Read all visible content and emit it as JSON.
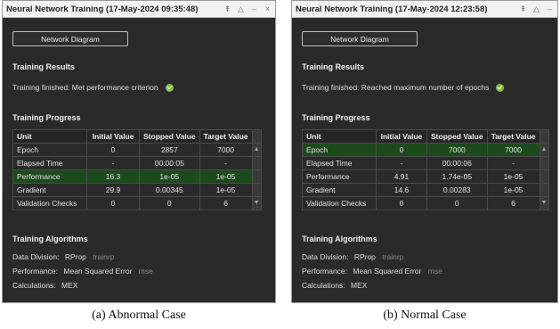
{
  "panels": [
    {
      "title": "Neural Network Training (17-May-2024 09:35:48)",
      "network_diagram_button": "Network Diagram",
      "training_results_heading": "Training Results",
      "training_results_text": "Training finished: Met performance criterion",
      "training_progress_heading": "Training Progress",
      "columns": [
        "Unit",
        "Initial Value",
        "Stopped Value",
        "Target Value"
      ],
      "rows": [
        {
          "unit": "Epoch",
          "initial": "0",
          "stopped": "2857",
          "target": "7000"
        },
        {
          "unit": "Elapsed Time",
          "initial": "-",
          "stopped": "00:00:05",
          "target": "-"
        },
        {
          "unit": "Performance",
          "initial": "16.3",
          "stopped": "1e-05",
          "target": "1e-05"
        },
        {
          "unit": "Gradient",
          "initial": "29.9",
          "stopped": "0.00345",
          "target": "1e-05"
        },
        {
          "unit": "Validation Checks",
          "initial": "0",
          "stopped": "0",
          "target": "6"
        }
      ],
      "highlighted_row": "Performance",
      "algorithms_heading": "Training Algorithms",
      "algorithms": [
        {
          "label": "Data Division:",
          "value": "RProp",
          "fn": "trainrp"
        },
        {
          "label": "Performance:",
          "value": "Mean Squared Error",
          "fn": "mse"
        },
        {
          "label": "Calculations:",
          "value": "MEX",
          "fn": ""
        }
      ],
      "caption": "(a) Abnormal Case"
    },
    {
      "title": "Neural Network Training (17-May-2024 12:23:58)",
      "network_diagram_button": "Network Diagram",
      "training_results_heading": "Training Results",
      "training_results_text": "Training finished: Reached maximum number of epochs",
      "training_progress_heading": "Training Progress",
      "columns": [
        "Unit",
        "Initial Value",
        "Stopped Value",
        "Target Value"
      ],
      "rows": [
        {
          "unit": "Epoch",
          "initial": "0",
          "stopped": "7000",
          "target": "7000"
        },
        {
          "unit": "Elapsed Time",
          "initial": "-",
          "stopped": "00:00:06",
          "target": "-"
        },
        {
          "unit": "Performance",
          "initial": "4.91",
          "stopped": "1.74e-05",
          "target": "1e-05"
        },
        {
          "unit": "Gradient",
          "initial": "14.6",
          "stopped": "0.00283",
          "target": "1e-05"
        },
        {
          "unit": "Validation Checks",
          "initial": "0",
          "stopped": "0",
          "target": "6"
        }
      ],
      "highlighted_row": "Epoch",
      "algorithms_heading": "Training Algorithms",
      "algorithms": [
        {
          "label": "Data Division:",
          "value": "RProp",
          "fn": "trainrp"
        },
        {
          "label": "Performance:",
          "value": "Mean Squared Error",
          "fn": "mse"
        },
        {
          "label": "Calculations:",
          "value": "MEX",
          "fn": ""
        }
      ],
      "caption": "(b) Normal Case"
    }
  ],
  "window_controls": {
    "pin": "⇞",
    "minimize": "–",
    "maximize": "△",
    "close": "×"
  },
  "icons": {
    "success": "check-circle-icon",
    "scroll_up": "triangle-up",
    "scroll_down": "triangle-down"
  },
  "colors": {
    "panel_bg": "#2a2a2a",
    "highlight": "#1d4a1d",
    "success": "#7cc242",
    "fn_gray": "#888888"
  }
}
